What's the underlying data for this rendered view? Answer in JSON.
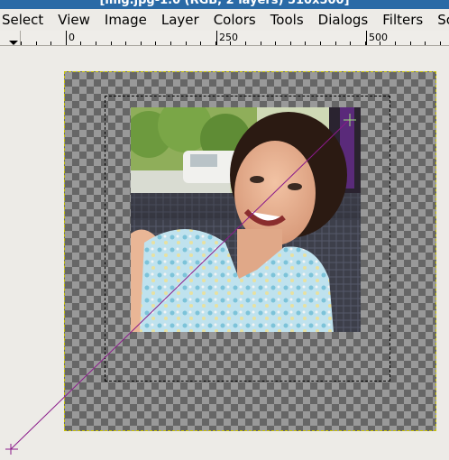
{
  "window": {
    "title": "[img.jpg-1.0 (RGB, 2 layers) 510x500]"
  },
  "menubar": {
    "items": [
      {
        "label": "Select"
      },
      {
        "label": "View"
      },
      {
        "label": "Image"
      },
      {
        "label": "Layer"
      },
      {
        "label": "Colors"
      },
      {
        "label": "Tools"
      },
      {
        "label": "Dialogs"
      },
      {
        "label": "Filters"
      },
      {
        "label": "Sc"
      }
    ]
  },
  "ruler": {
    "labels": [
      "0",
      "250",
      "500"
    ]
  },
  "canvas": {
    "layer_boundary_color": "#c9c400",
    "line_color": "#8a1a8a",
    "photo_description_icon": "portrait-photo"
  }
}
